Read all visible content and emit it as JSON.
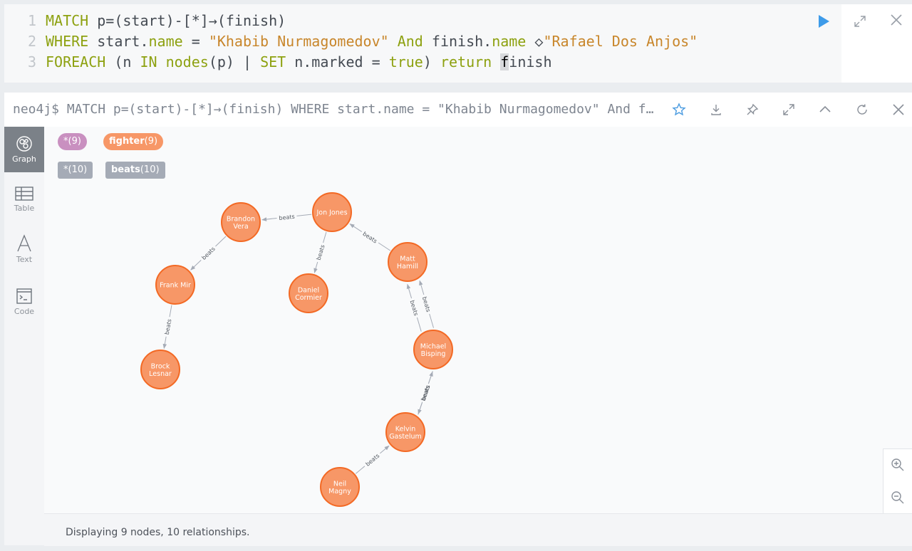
{
  "editor": {
    "lines": [
      {
        "num": "1",
        "parts": [
          {
            "t": "MATCH",
            "c": "kw"
          },
          {
            "t": " p=(start)-[*]→(finish)",
            "c": "tx"
          }
        ]
      },
      {
        "num": "2",
        "parts": [
          {
            "t": "WHERE",
            "c": "kw"
          },
          {
            "t": " start.",
            "c": "tx"
          },
          {
            "t": "name",
            "c": "kw"
          },
          {
            "t": " = ",
            "c": "tx"
          },
          {
            "t": "\"Khabib Nurmagomedov\"",
            "c": "str"
          },
          {
            "t": " And",
            "c": "kw"
          },
          {
            "t": " finish.",
            "c": "tx"
          },
          {
            "t": "name",
            "c": "kw"
          },
          {
            "t": " ◇",
            "c": "tx"
          },
          {
            "t": "\"Rafael Dos Anjos\"",
            "c": "str"
          }
        ]
      },
      {
        "num": "3",
        "parts": [
          {
            "t": "FOREACH",
            "c": "kw"
          },
          {
            "t": " (n ",
            "c": "tx"
          },
          {
            "t": "IN",
            "c": "kw"
          },
          {
            "t": " nodes",
            "c": "kw"
          },
          {
            "t": "(p) | ",
            "c": "tx"
          },
          {
            "t": "SET",
            "c": "kw"
          },
          {
            "t": " n.marked = ",
            "c": "tx"
          },
          {
            "t": "true",
            "c": "kw"
          },
          {
            "t": ") ",
            "c": "tx"
          },
          {
            "t": "return",
            "c": "kw"
          },
          {
            "t": " ",
            "c": "tx"
          },
          {
            "t": "f",
            "c": "cur"
          },
          {
            "t": "inish",
            "c": "tx"
          }
        ]
      }
    ],
    "icons": {
      "run": "play-icon",
      "expand": "expand-icon",
      "close": "close-icon"
    },
    "run_color": "#3d9be9"
  },
  "frame": {
    "command": "neo4j$ MATCH p=(start)-[*]→(finish) WHERE start.name = \"Khabib Nurmagomedov\" And finish.name ◇\"Rafael Dos Anjos\" FOREACH (n IN nodes(p) | SET n.marked = true) return finish",
    "icons": [
      "star-icon",
      "download-icon",
      "pin-icon",
      "fullscreen-icon",
      "collapse-icon",
      "refresh-icon",
      "close-icon"
    ]
  },
  "sidebar": {
    "items": [
      {
        "label": "Graph",
        "icon": "graph-icon",
        "active": true
      },
      {
        "label": "Table",
        "icon": "table-icon",
        "active": false
      },
      {
        "label": "Text",
        "icon": "text-icon",
        "active": false
      },
      {
        "label": "Code",
        "icon": "code-icon",
        "active": false
      }
    ]
  },
  "legend": {
    "labels": [
      {
        "name": "*",
        "count": "(9)",
        "color": "#c990c0"
      },
      {
        "name": "fighter",
        "count": "(9)",
        "color": "#f79767"
      }
    ],
    "relationships": [
      {
        "name": "*",
        "count": "(10)",
        "color": "#a5abb6"
      },
      {
        "name": "beats",
        "count": "(10)",
        "color": "#a5abb6"
      }
    ]
  },
  "graph": {
    "node_color": "#f79767",
    "node_border": "#f36924",
    "edge_color": "#a5abb6",
    "nodes": [
      {
        "id": "jon",
        "lines": [
          "Jon Jones"
        ]
      },
      {
        "id": "brandon",
        "lines": [
          "Brandon",
          "Vera"
        ]
      },
      {
        "id": "matt",
        "lines": [
          "Matt",
          "Hamill"
        ]
      },
      {
        "id": "frank",
        "lines": [
          "Frank Mir"
        ]
      },
      {
        "id": "daniel",
        "lines": [
          "Daniel",
          "Cormier"
        ]
      },
      {
        "id": "michael",
        "lines": [
          "Michael",
          "Bisping"
        ]
      },
      {
        "id": "brock",
        "lines": [
          "Brock",
          "Lesnar"
        ]
      },
      {
        "id": "kelvin",
        "lines": [
          "Kelvin",
          "Gastelum"
        ]
      },
      {
        "id": "neil",
        "lines": [
          "Neil",
          "Magny"
        ]
      }
    ],
    "edges": [
      {
        "from": "jon",
        "to": "brandon",
        "label": "beats"
      },
      {
        "from": "jon",
        "to": "daniel",
        "label": "beats"
      },
      {
        "from": "matt",
        "to": "jon",
        "label": "beats"
      },
      {
        "from": "brandon",
        "to": "frank",
        "label": "beats"
      },
      {
        "from": "frank",
        "to": "brock",
        "label": "beats"
      },
      {
        "from": "michael",
        "to": "matt",
        "label": "beats"
      },
      {
        "from": "michael",
        "to": "matt",
        "label": "beats"
      },
      {
        "from": "michael",
        "to": "kelvin",
        "label": "beats"
      },
      {
        "from": "kelvin",
        "to": "michael",
        "label": "beats"
      },
      {
        "from": "neil",
        "to": "kelvin",
        "label": "beats"
      }
    ]
  },
  "zoom": {
    "in_icon": "zoom-in-icon",
    "out_icon": "zoom-out-icon"
  },
  "status": "Displaying 9 nodes, 10 relationships."
}
